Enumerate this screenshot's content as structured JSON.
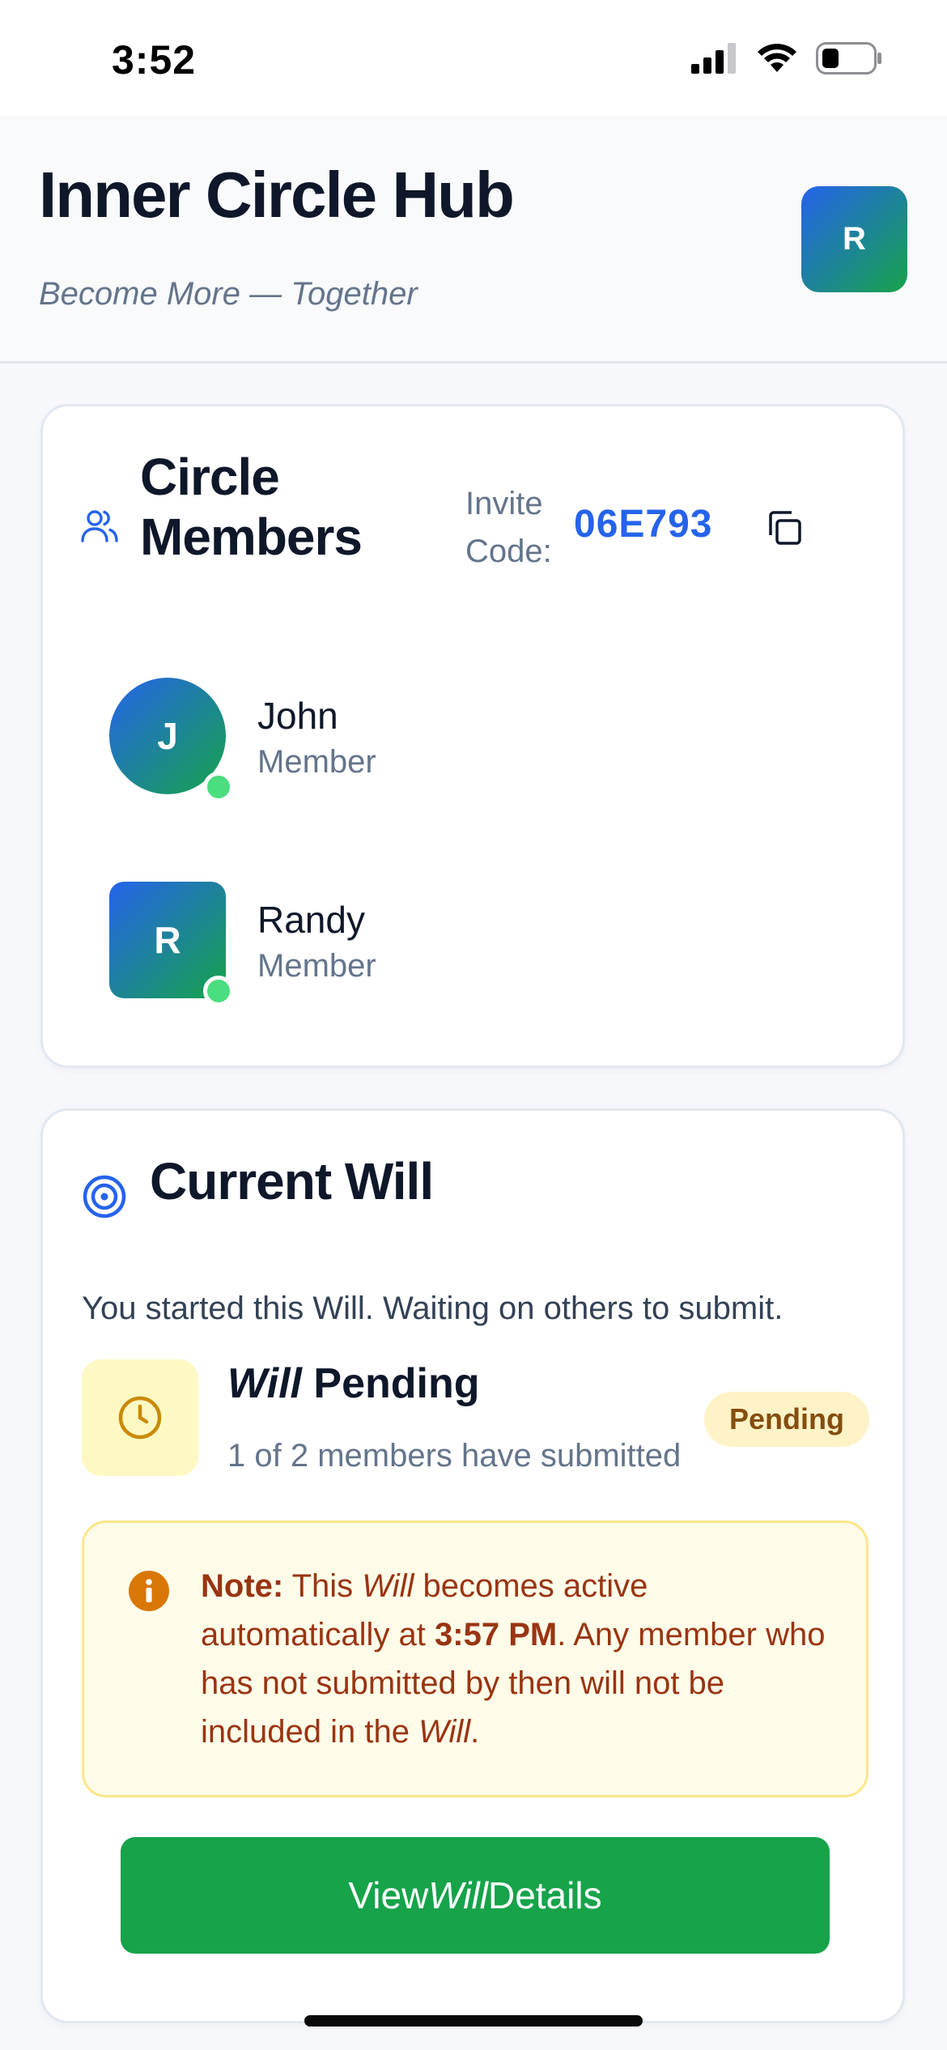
{
  "status_bar": {
    "time": "3:52"
  },
  "header": {
    "title": "Inner Circle Hub",
    "subtitle": "Become More — Together",
    "user_avatar_initial": "R"
  },
  "members_card": {
    "title": "Circle Members",
    "invite_label": "Invite Code:",
    "invite_code": "06E793",
    "members": [
      {
        "initial": "J",
        "name": "John",
        "role": "Member",
        "online": true
      },
      {
        "initial": "R",
        "name": "Randy",
        "role": "Member",
        "online": true
      }
    ]
  },
  "will_card": {
    "title": "Current Will",
    "description": "You started this Will. Waiting on others to submit.",
    "pending_title_italic": "Will",
    "pending_title_rest": " Pending",
    "pending_subtitle": "1 of 2 members have submitted",
    "badge": "Pending",
    "note": {
      "label": "Note:",
      "part1": " This ",
      "will_word": "Will",
      "part2": " becomes active automatically at ",
      "time": "3:57 PM",
      "part3": ". Any member who has not submitted by then will not be included in the ",
      "will_word2": "Will",
      "part4": "."
    },
    "button": {
      "prefix": "View",
      "italic": "Will",
      "suffix": "Details"
    }
  },
  "colors": {
    "accent_blue": "#2563eb",
    "accent_green": "#16a34a",
    "pending_bg": "#fef3c7",
    "note_text": "#9a3412"
  },
  "icons": {
    "members": "users-icon",
    "copy": "copy-icon",
    "will": "target-icon",
    "clock": "clock-icon",
    "note": "info-icon"
  }
}
